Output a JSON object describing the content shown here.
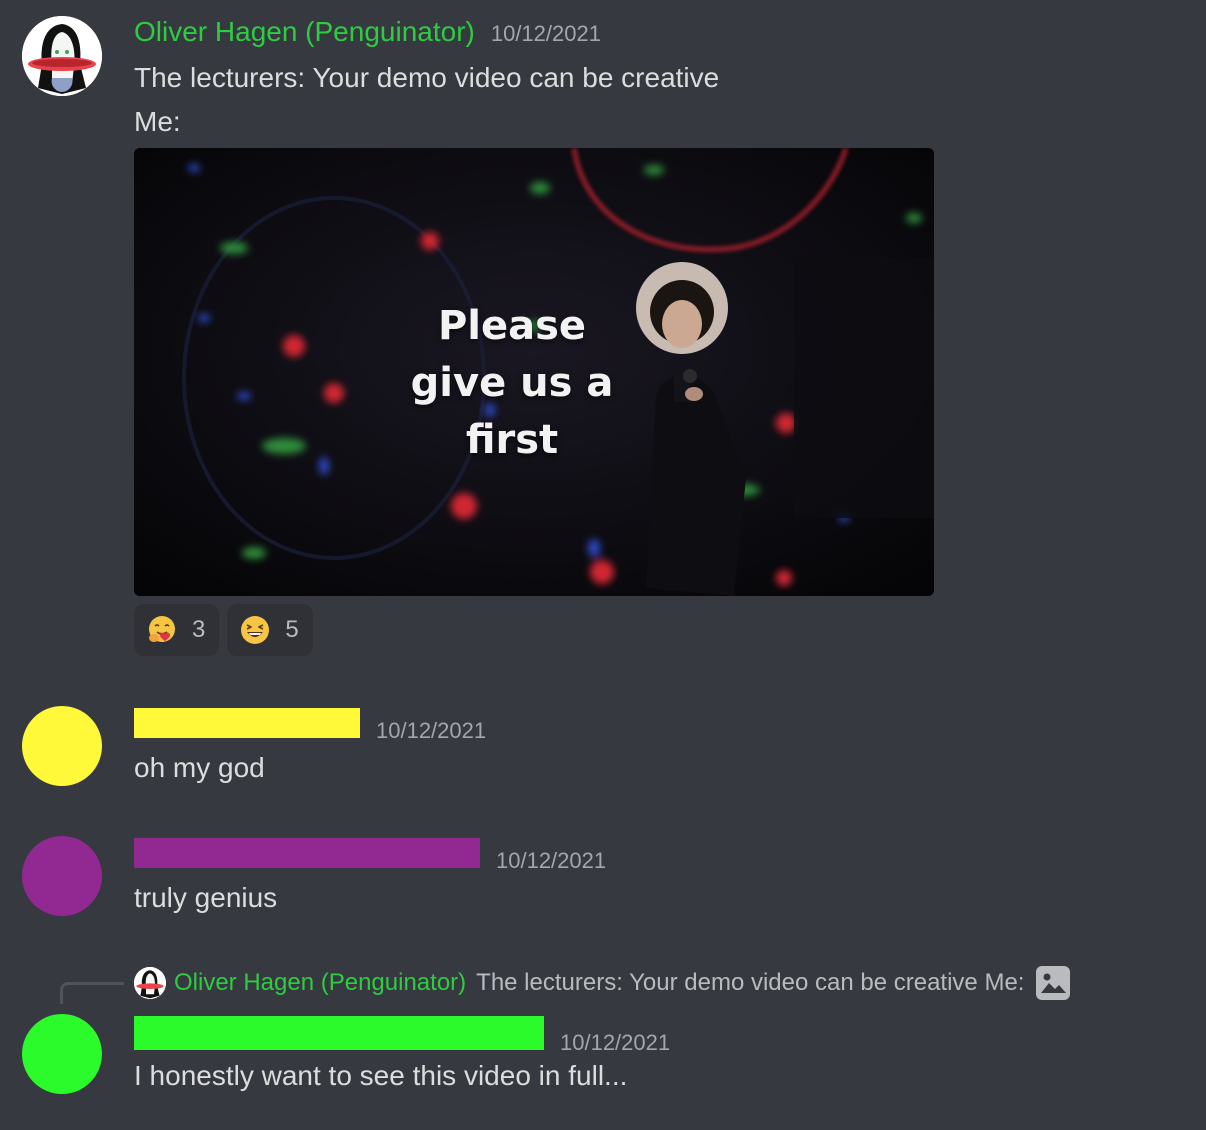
{
  "messages": [
    {
      "username": "Oliver Hagen (Penguinator)",
      "timestamp": "10/12/2021",
      "lines": [
        "The lecturers: Your demo video can be creative",
        "Me:"
      ],
      "video_caption": "Please give us a first",
      "reactions": [
        {
          "emoji": "hugging-face-icon",
          "count": "3"
        },
        {
          "emoji": "laughing-face-icon",
          "count": "5"
        }
      ]
    },
    {
      "username_redacted_color": "#fff93a",
      "timestamp": "10/12/2021",
      "text": "oh my god"
    },
    {
      "username_redacted_color": "#922891",
      "timestamp": "10/12/2021",
      "text": "truly genius"
    },
    {
      "reply": {
        "username": "Oliver Hagen (Penguinator)",
        "text": "The lecturers: Your demo video can be creative Me:",
        "icon": "image-icon"
      },
      "username_redacted_color": "#2bfb2b",
      "timestamp": "10/12/2021",
      "text": "I honestly want to see this video in full..."
    }
  ],
  "colors": {
    "background": "#36393f",
    "username_green": "#2ecc40"
  }
}
